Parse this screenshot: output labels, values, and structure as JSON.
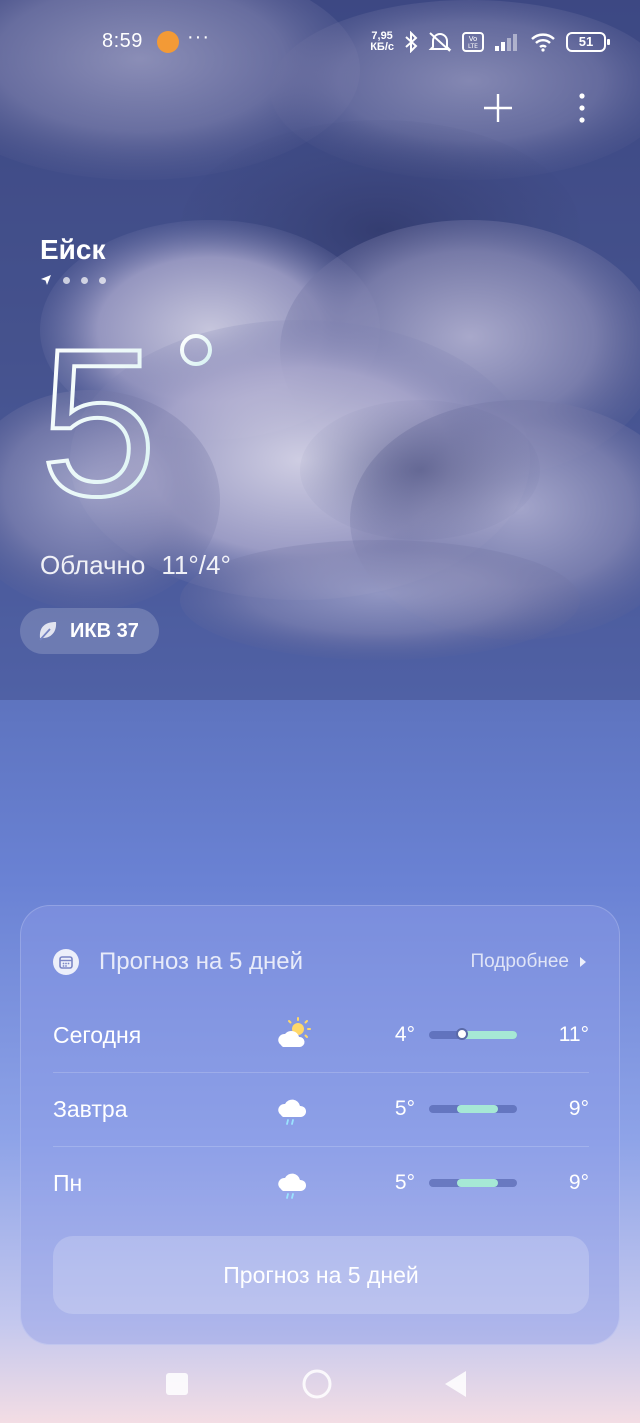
{
  "status_bar": {
    "time": "8:59",
    "more": "···",
    "speed_value": "7,95",
    "speed_unit": "КБ/с",
    "volte": "Vo LTE",
    "battery": "51"
  },
  "location": {
    "city": "Ейск",
    "pages_total": 4,
    "current_page": 1
  },
  "current": {
    "temperature": "5",
    "condition": "Облачно",
    "range": "11°/4°",
    "aqi_label": "ИКВ 37"
  },
  "forecast": {
    "title": "Прогноз на 5 дней",
    "more_label": "Подробнее",
    "days": [
      {
        "day": "Сегодня",
        "icon": "partly-sunny-icon",
        "low": "4°",
        "high": "11°",
        "bar_start": 0.32,
        "bar_end": 1.0,
        "now": 0.38
      },
      {
        "day": "Завтра",
        "icon": "rain-cloud-icon",
        "low": "5°",
        "high": "9°",
        "bar_start": 0.32,
        "bar_end": 0.78
      },
      {
        "day": "Пн",
        "icon": "rain-cloud-icon",
        "low": "5°",
        "high": "9°",
        "bar_start": 0.32,
        "bar_end": 0.78
      }
    ],
    "button_label": "Прогноз на 5 дней"
  },
  "colors": {
    "accent_bar": "#a6e8d5",
    "app_icon": "#f39a36"
  }
}
